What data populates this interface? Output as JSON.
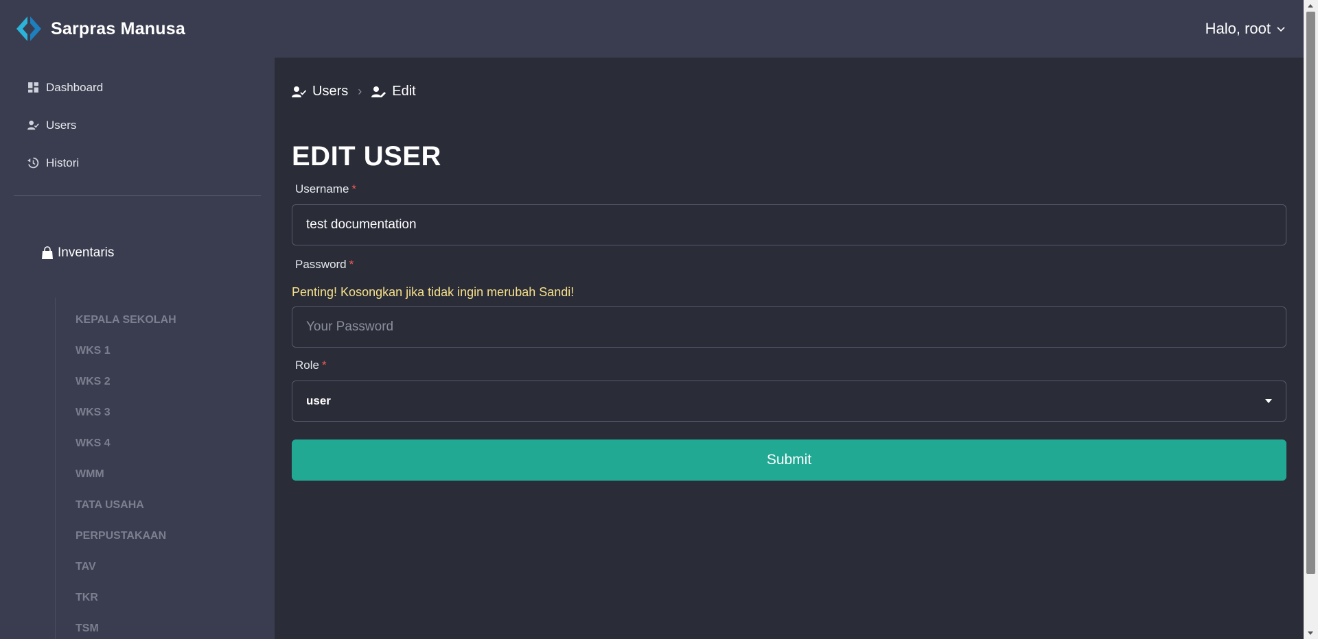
{
  "brand": {
    "name": "Sarpras Manusa",
    "logo_icon": "diamond-arrows-logo"
  },
  "header": {
    "greeting": "Halo, root",
    "dropdown_icon": "chevron-down-icon"
  },
  "sidebar": {
    "items": [
      {
        "label": "Dashboard",
        "icon": "dashboard-icon"
      },
      {
        "label": "Users",
        "icon": "user-check-icon"
      },
      {
        "label": "Histori",
        "icon": "history-icon"
      }
    ],
    "inventaris": {
      "label": "Inventaris",
      "icon": "bag-icon",
      "sub_items": [
        "KEPALA SEKOLAH",
        "WKS 1",
        "WKS 2",
        "WKS 3",
        "WKS 4",
        "WMM",
        "TATA USAHA",
        "PERPUSTAKAAN",
        "TAV",
        "TKR",
        "TSM"
      ]
    }
  },
  "breadcrumb": {
    "parent": "Users",
    "current": "Edit"
  },
  "page": {
    "title": "EDIT USER"
  },
  "form": {
    "username_label": "Username",
    "username_value": "test documentation",
    "password_label": "Password",
    "password_warning": "Penting! Kosongkan jika tidak ingin merubah Sandi!",
    "password_placeholder": "Your Password",
    "role_label": "Role",
    "role_value": "user",
    "required_mark": "*",
    "submit_label": "Submit"
  },
  "colors": {
    "accent": "#21a994",
    "warning": "#f6e08a",
    "required": "#f15a5a",
    "topbar": "#3a3d4f",
    "background": "#2a2c38"
  }
}
